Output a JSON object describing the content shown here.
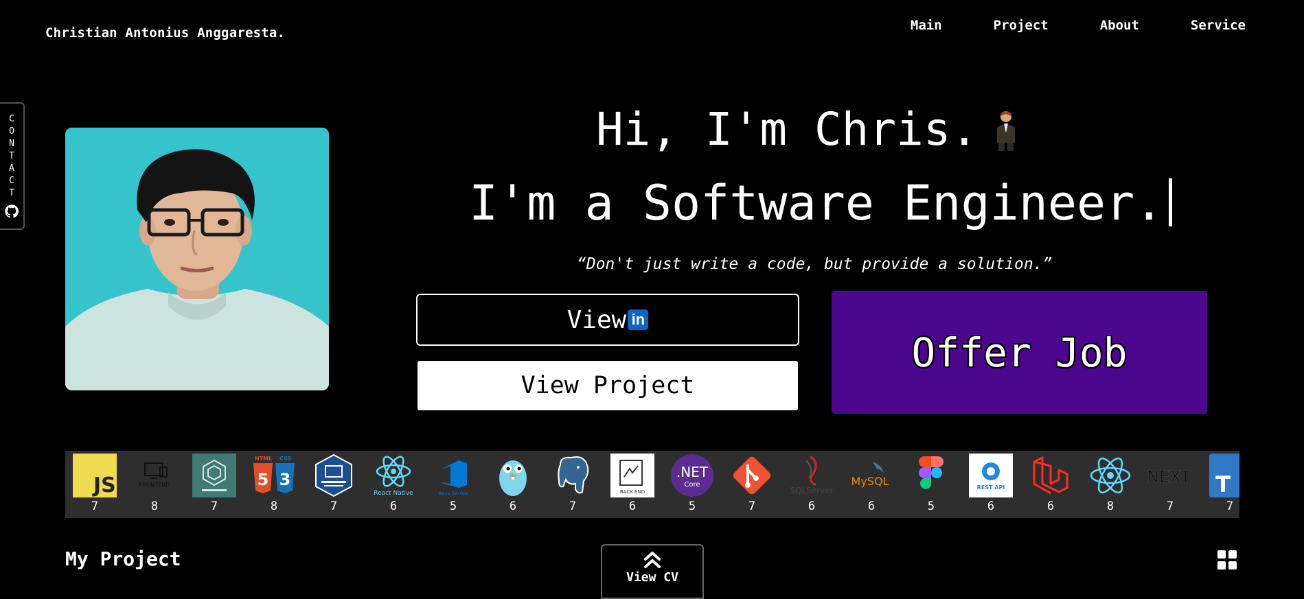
{
  "header": {
    "brand": "Christian Antonius Anggaresta.",
    "nav": [
      "Main",
      "Project",
      "About",
      "Service"
    ]
  },
  "contact_tab": {
    "letters": [
      "C",
      "O",
      "N",
      "T",
      "A",
      "C",
      "T"
    ],
    "icon": "github-icon"
  },
  "hero": {
    "line1": "Hi, I'm Chris.",
    "line2": "I'm a Software Engineer.",
    "quote": "“Don't just write a code, but provide a solution.”",
    "linkedin_button_label": "View",
    "linkedin_badge": "in",
    "project_button_label": "View Project",
    "offer_button_label": "Offer Job"
  },
  "colors": {
    "photo_bg": "#35c4cc",
    "offer_bg": "#4c078e",
    "linkedin": "#0a66c2",
    "skills_bg": "#2e2e2e"
  },
  "skills": [
    {
      "name": "javascript",
      "level": "7"
    },
    {
      "name": "frontend",
      "level": "8"
    },
    {
      "name": "software-development",
      "level": "7"
    },
    {
      "name": "html5-css3",
      "level": "8"
    },
    {
      "name": "software-engineering",
      "level": "7"
    },
    {
      "name": "react-native",
      "level": "6"
    },
    {
      "name": "azure-devops",
      "level": "5"
    },
    {
      "name": "golang",
      "level": "6"
    },
    {
      "name": "postgresql",
      "level": "7"
    },
    {
      "name": "back-end",
      "level": "6"
    },
    {
      "name": "dotnet-core",
      "level": "5"
    },
    {
      "name": "git",
      "level": "7"
    },
    {
      "name": "sql-server",
      "level": "6"
    },
    {
      "name": "mysql",
      "level": "6"
    },
    {
      "name": "figma",
      "level": "5"
    },
    {
      "name": "rest-api",
      "level": "6"
    },
    {
      "name": "laravel",
      "level": "6"
    },
    {
      "name": "react",
      "level": "8"
    },
    {
      "name": "nextjs",
      "level": "7"
    },
    {
      "name": "typescript",
      "level": "7"
    }
  ],
  "skill_icon_text": {
    "js": "JS",
    "frontend": "FRONTEND",
    "html": "HTML",
    "css": "CSS",
    "react_native": "React Native",
    "azure": "Azure DevOps",
    "backend": "BACK END",
    "net": ".NET",
    "core": "Core",
    "sqlserver": "SQLServer",
    "mysql": "MySQL",
    "restapi": "REST API",
    "next": "NEXT",
    "ts": "T"
  },
  "projects": {
    "title": "My Project"
  },
  "view_cv": {
    "label": "View CV"
  }
}
